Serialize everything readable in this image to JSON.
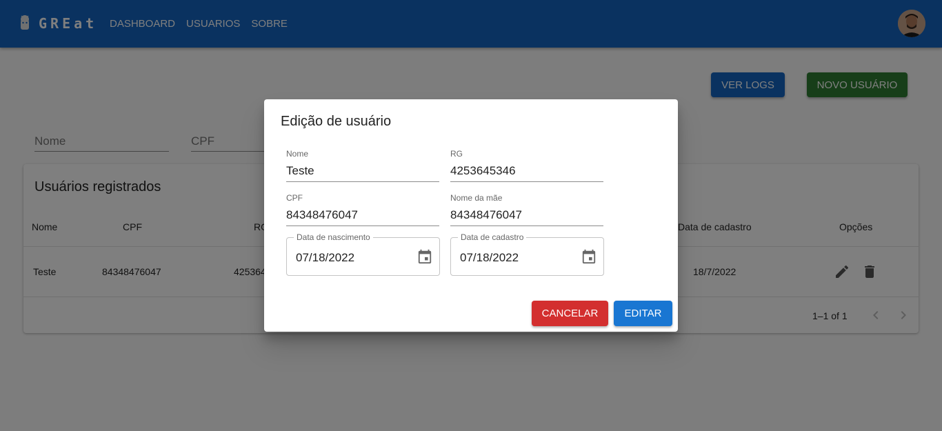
{
  "appbar": {
    "logo_text": "GREat",
    "nav": [
      "DASHBOARD",
      "USUARIOS",
      "SOBRE"
    ]
  },
  "actions": {
    "logs_label": "VER LOGS",
    "new_user_label": "NOVO USUÁRIO"
  },
  "filters": {
    "nome_placeholder": "Nome",
    "cpf_placeholder": "CPF"
  },
  "table": {
    "title": "Usuários registrados",
    "headers": {
      "nome": "Nome",
      "cpf": "CPF",
      "rg": "RG",
      "data_cadastro": "Data de cadastro",
      "opcoes": "Opções"
    },
    "rows": [
      {
        "nome": "Teste",
        "cpf": "84348476047",
        "rg": "4253645346",
        "data_cadastro": "18/7/2022"
      }
    ],
    "pagination": "1–1 of 1"
  },
  "dialog": {
    "title": "Edição de usuário",
    "fields": {
      "nome": {
        "label": "Nome",
        "value": "Teste"
      },
      "rg": {
        "label": "RG",
        "value": "4253645346"
      },
      "cpf": {
        "label": "CPF",
        "value": "84348476047"
      },
      "nome_mae": {
        "label": "Nome da mãe",
        "value": "84348476047"
      },
      "data_nascimento": {
        "label": "Data de nascimento",
        "value": "07/18/2022"
      },
      "data_cadastro": {
        "label": "Data de cadastro",
        "value": "07/18/2022"
      }
    },
    "cancel_label": "CANCELAR",
    "edit_label": "EDITAR"
  },
  "colors": {
    "primary": "#1565c0",
    "success": "#2e7d32",
    "danger": "#d32f2f",
    "edit": "#1976d2"
  },
  "icons": [
    "android-icon",
    "avatar",
    "edit-icon",
    "delete-icon",
    "chevron-left-icon",
    "chevron-right-icon",
    "calendar-icon"
  ]
}
